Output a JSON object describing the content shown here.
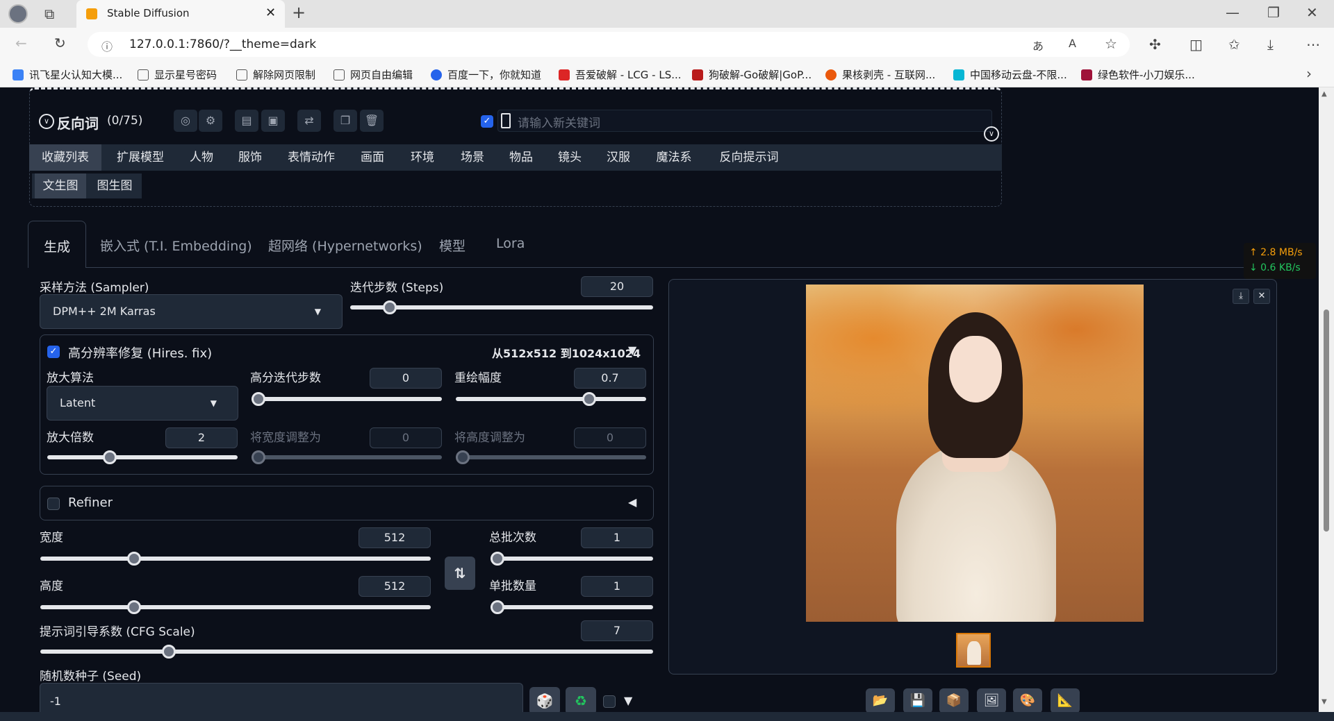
{
  "browser": {
    "tab_title": "Stable Diffusion",
    "url": "127.0.0.1:7860/?__theme=dark",
    "bookmarks": [
      "讯飞星火认知大模...",
      "显示星号密码",
      "解除网页限制",
      "网页自由编辑",
      "百度一下，你就知道",
      "吾爱破解 - LCG - LS...",
      "狗破解-Go破解|GoP...",
      "果核剥壳 - 互联网...",
      "中国移动云盘-不限...",
      "绿色软件-小刀娱乐..."
    ]
  },
  "negative": {
    "title": "反向词",
    "count": "(0/75)",
    "keyword_placeholder": "请输入新关键词"
  },
  "categories": [
    "收藏列表",
    "扩展模型",
    "人物",
    "服饰",
    "表情动作",
    "画面",
    "环境",
    "场景",
    "物品",
    "镜头",
    "汉服",
    "魔法系",
    "反向提示词"
  ],
  "subcategories": [
    "文生图",
    "图生图"
  ],
  "main_tabs": [
    "生成",
    "嵌入式 (T.I. Embedding)",
    "超网络 (Hypernetworks)",
    "模型",
    "Lora"
  ],
  "net_speed": {
    "up": "↑ 2.8 MB/s",
    "down": "↓ 0.6 KB/s"
  },
  "sampler": {
    "label": "采样方法 (Sampler)",
    "value": "DPM++ 2M Karras"
  },
  "steps": {
    "label": "迭代步数 (Steps)",
    "value": "20",
    "fraction": 0.13
  },
  "hires": {
    "label": "高分辨率修复 (Hires. fix)",
    "summary": "从512x512 到1024x1024",
    "upscaler_label": "放大算法",
    "upscaler": "Latent",
    "hr_steps_label": "高分迭代步数",
    "hr_steps": "0",
    "hr_steps_fraction": 0.0,
    "denoise_label": "重绘幅度",
    "denoise": "0.7",
    "denoise_fraction": 0.7,
    "scale_label": "放大倍数",
    "scale": "2",
    "scale_fraction": 0.33,
    "resize_w_label": "将宽度调整为",
    "resize_w": "0",
    "resize_h_label": "将高度调整为",
    "resize_h": "0"
  },
  "refiner": {
    "label": "Refiner"
  },
  "width": {
    "label": "宽度",
    "value": "512",
    "fraction": 0.24
  },
  "height": {
    "label": "高度",
    "value": "512",
    "fraction": 0.24
  },
  "batch_count": {
    "label": "总批次数",
    "value": "1",
    "fraction": 0.0
  },
  "batch_size": {
    "label": "单批数量",
    "value": "1",
    "fraction": 0.0
  },
  "cfg": {
    "label": "提示词引导系数 (CFG Scale)",
    "value": "7",
    "fraction": 0.21
  },
  "seed": {
    "label": "随机数种子 (Seed)",
    "value": "-1"
  },
  "colors": {
    "accent": "#2563eb",
    "panel": "#0b0f19",
    "border": "#374151",
    "up": "#f59e0b",
    "down": "#22c55e"
  }
}
